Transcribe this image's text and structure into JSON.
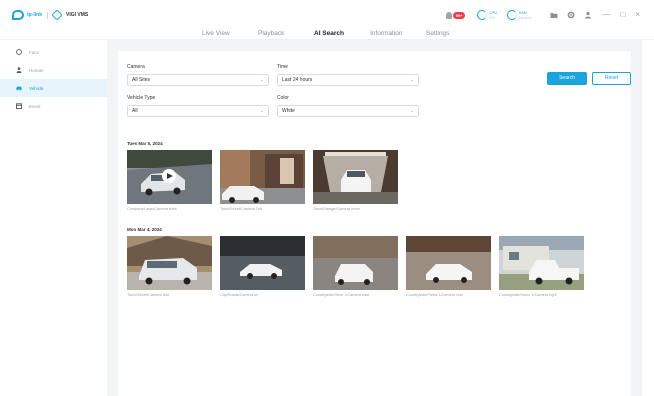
{
  "app": {
    "logo_text": "tp-link",
    "product_text": "VIGI VMS"
  },
  "tabs": [
    {
      "label": "Live View"
    },
    {
      "label": "Playback"
    },
    {
      "label": "AI Search"
    },
    {
      "label": "Information"
    },
    {
      "label": "Settings"
    }
  ],
  "active_tab": "AI Search",
  "header": {
    "alarm_count": "99+",
    "stats": [
      {
        "title": "CPU",
        "sub": "0%"
      },
      {
        "title": "RAM",
        "sub": "Memory"
      }
    ]
  },
  "sidebar": {
    "items": [
      {
        "label": "Face",
        "icon": "face-icon"
      },
      {
        "label": "Human",
        "icon": "person-icon"
      },
      {
        "label": "Vehicle",
        "icon": "vehicle-icon"
      },
      {
        "label": "Event",
        "icon": "event-icon"
      }
    ],
    "active_index": 2
  },
  "filters": {
    "camera_label": "Camera",
    "camera_value": "All Sites",
    "time_label": "Time",
    "time_value": "Last 24 hours",
    "vehicle_type_label": "Vehicle Type",
    "vehicle_type_value": "All",
    "color_label": "Color",
    "color_value": "White",
    "search_label": "Search",
    "reset_label": "Reset"
  },
  "groups": [
    {
      "date": "Tues Mar 5,  2024",
      "items": [
        {
          "caption": "Company/Lawn/Camera front"
        },
        {
          "caption": "Town/Street/Camera 2nd"
        },
        {
          "caption": "Town/Garage/Camera Inner"
        }
      ]
    },
    {
      "date": "Mon Mar 4,  2024",
      "items": [
        {
          "caption": "Town/Street/Camera first"
        },
        {
          "caption": "City/Roads/Camera on"
        },
        {
          "caption": "Countryside/Drive 1/Camera east"
        },
        {
          "caption": "Countryside/Fields 1/Camera rear"
        },
        {
          "caption": "Countryside/Home 1/Camera right"
        }
      ]
    }
  ],
  "colors": {
    "accent": "#19a4dc",
    "badge": "#e8404a",
    "panel_bg": "#f3f4f6"
  }
}
